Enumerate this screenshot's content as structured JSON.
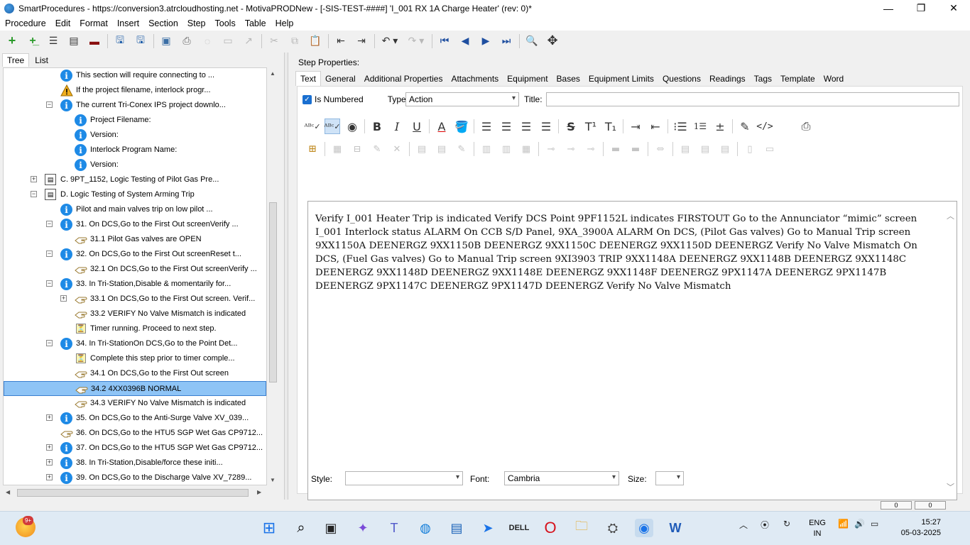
{
  "window": {
    "title": "SmartProcedures - https://conversion3.atrcloudhosting.net - MotivaPRODNew - [-SIS-TEST-####] 'I_001 RX 1A Charge Heater' (rev: 0)*",
    "minimize": "—",
    "maximize": "❐",
    "close": "✕"
  },
  "menu": [
    "Procedure",
    "Edit",
    "Format",
    "Insert",
    "Section",
    "Step",
    "Tools",
    "Table",
    "Help"
  ],
  "left_tabs": [
    "Tree",
    "List"
  ],
  "tree": [
    {
      "label": "This section will require connecting to ...",
      "icon": "info-icon"
    },
    {
      "label": "If the project filename, interlock progr...",
      "icon": "warning-icon"
    },
    {
      "label": "The current Tri-Conex IPS project downlo...",
      "icon": "info-icon"
    },
    {
      "label": "Project Filename:",
      "icon": "info-icon"
    },
    {
      "label": "Version:",
      "icon": "info-icon"
    },
    {
      "label": "Interlock Program Name:",
      "icon": "info-icon"
    },
    {
      "label": "Version:",
      "icon": "info-icon"
    },
    {
      "label": "C. 9PT_1152, Logic Testing of Pilot Gas Pre...",
      "icon": "section-icon"
    },
    {
      "label": "D. Logic Testing of System Arming Trip",
      "icon": "section-icon"
    },
    {
      "label": "Pilot and main valves trip on low pilot ...",
      "icon": "info-icon"
    },
    {
      "label": "31. On DCS,Go to the First Out screenVerify ...",
      "icon": "info-icon"
    },
    {
      "label": "31.1 Pilot Gas valves are OPEN",
      "icon": "hand-icon"
    },
    {
      "label": "32. On DCS,Go to the First Out screenReset t...",
      "icon": "info-icon"
    },
    {
      "label": "32.1 On DCS,Go to the First Out screenVerify ...",
      "icon": "hand-icon"
    },
    {
      "label": "33. In Tri-Station,Disable & momentarily for...",
      "icon": "info-icon"
    },
    {
      "label": "33.1 On DCS,Go to the First Out screen. Verif...",
      "icon": "hand-icon"
    },
    {
      "label": "33.2 VERIFY No Valve Mismatch is indicated",
      "icon": "hand-icon"
    },
    {
      "label": "Timer running. Proceed to next step.",
      "icon": "timer-icon"
    },
    {
      "label": "34. In Tri-StationOn DCS,Go to the Point Det...",
      "icon": "info-icon"
    },
    {
      "label": "Complete this step prior to timer comple...",
      "icon": "timer-icon"
    },
    {
      "label": "34.1 On DCS,Go to the First Out screen",
      "icon": "hand-icon"
    },
    {
      "label": "34.2 4XX0396B        NORMAL",
      "icon": "hand-icon"
    },
    {
      "label": "34.3 VERIFY No Valve Mismatch is indicated",
      "icon": "hand-icon"
    },
    {
      "label": "35. On DCS,Go to the Anti-Surge Valve XV_039...",
      "icon": "info-icon"
    },
    {
      "label": "36. On DCS,Go to the HTU5 SGP Wet Gas CP9712...",
      "icon": "hand-icon"
    },
    {
      "label": "37. On DCS,Go to the HTU5 SGP Wet Gas CP9712...",
      "icon": "info-icon"
    },
    {
      "label": "38. In Tri-Station,Disable/force these initi...",
      "icon": "info-icon"
    },
    {
      "label": "39. On DCS,Go to the Discharge Valve XV_7289...",
      "icon": "info-icon"
    }
  ],
  "step_props_label": "Step Properties:",
  "right_tabs": [
    "Text",
    "General",
    "Additional Properties",
    "Attachments",
    "Equipment",
    "Bases",
    "Equipment Limits",
    "Questions",
    "Readings",
    "Tags",
    "Template",
    "Word"
  ],
  "options": {
    "is_numbered_label": "Is Numbered",
    "type_label": "Type:",
    "type_value": "Action",
    "title_label": "Title:"
  },
  "editor_text": "Verify I_001 Heater Trip is indicated Verify DCS Point 9PF1152L indicates FIRSTOUT Go to the Annunciator “mimic” screen I_001 Interlock status ALARM   On CCB S/D Panel, 9XA_3900A ALARM   On DCS, (Pilot Gas valves) Go to Manual Trip screen 9XX1150A DEENERGZ 9XX1150B DEENERGZ 9XX1150C DEENERGZ 9XX1150D DEENERGZ Verify No Valve Mismatch   On DCS, (Fuel Gas valves) Go to Manual Trip screen 9XI3903 TRIP 9XX1148A DEENERGZ 9XX1148B DEENERGZ 9XX1148C DEENERGZ 9XX1148D DEENERGZ 9XX1148E DEENERGZ 9XX1148F DEENERGZ 9PX1147A DEENERGZ 9PX1147B DEENERGZ 9PX1147C DEENERGZ 9PX1147D DEENERGZ Verify No Valve Mismatch",
  "bottom": {
    "style_label": "Style:",
    "style_value": "",
    "font_label": "Font:",
    "font_value": "Cambria",
    "size_label": "Size:",
    "size_value": ""
  },
  "status_counters": [
    "0",
    "0"
  ],
  "taskbar": {
    "badge": "9+",
    "lang_1": "ENG",
    "lang_2": "IN",
    "time": "15:27",
    "date": "05-03-2025"
  }
}
